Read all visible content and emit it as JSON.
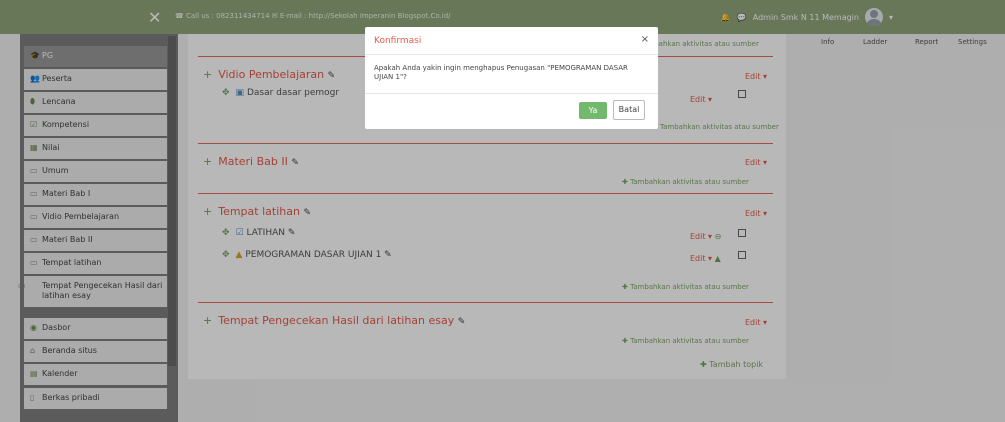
{
  "navbar": {
    "close_glyph": "✕",
    "contact": "☎ Call us : 082311434714 ✉ E-mail : http://Sekolah Imperanin Blogspot.Co.id/",
    "bell_glyph": "🔔",
    "chat_glyph": "💬",
    "user_name": "Admin Smk N 11 Memagin",
    "caret": "▾"
  },
  "drawer": {
    "items": [
      {
        "icon": "🎓",
        "label": "PG"
      },
      {
        "icon": "👥",
        "label": "Peserta"
      },
      {
        "icon": "⬮",
        "label": "Lencana"
      },
      {
        "icon": "☑",
        "label": "Kompetensi"
      },
      {
        "icon": "▦",
        "label": "Nilai"
      },
      {
        "icon": "▭",
        "label": "Umum"
      },
      {
        "icon": "▭",
        "label": "Materi Bab I"
      },
      {
        "icon": "▭",
        "label": "Vidio Pembelajaran"
      },
      {
        "icon": "▭",
        "label": "Materi Bab II"
      },
      {
        "icon": "▭",
        "label": "Tempat latihan"
      },
      {
        "icon": "▭",
        "label": "Tempat Pengecekan Hasil dari latihan esay"
      },
      {
        "icon": "◉",
        "label": "Dasbor"
      },
      {
        "icon": "⌂",
        "label": "Beranda situs"
      },
      {
        "icon": "▤",
        "label": "Kalender"
      },
      {
        "icon": "▯",
        "label": "Berkas pribadi"
      }
    ]
  },
  "course": {
    "add_activity": "Tambahkan aktivitas atau sumber",
    "edit_label": "Edit",
    "add_topic": "Tambah topik",
    "sections": [
      {
        "title": "Vidio Pembelajaran",
        "activities": [
          "Dasar dasar pemogr"
        ]
      },
      {
        "title": "Materi Bab II",
        "activities": []
      },
      {
        "title": "Tempat latihan",
        "activities": [
          "LATIHAN",
          "PEMOGRAMAN DASAR UJIAN 1"
        ]
      },
      {
        "title": "Tempat Pengecekan Hasil dari latihan esay",
        "activities": []
      }
    ]
  },
  "right_block": {
    "items": [
      "Info",
      "Ladder",
      "Report",
      "Settings"
    ]
  },
  "modal": {
    "title": "Konfirmasi",
    "close_glyph": "×",
    "message": "Apakah Anda yakin ingin menghapus Penugasan \"PEMOGRAMAN DASAR UJIAN 1\"?",
    "confirm_label": "Ya",
    "cancel_label": "Batal"
  }
}
